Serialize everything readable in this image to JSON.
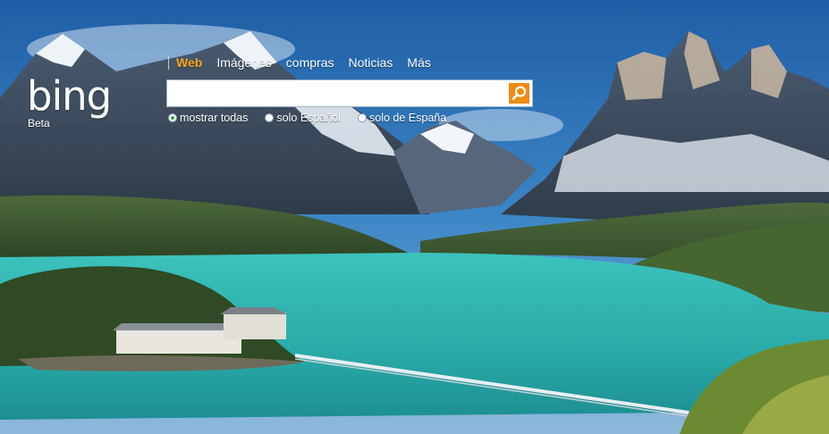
{
  "brand": {
    "logo_text": "bing",
    "beta_label": "Beta"
  },
  "nav": {
    "items": [
      {
        "label": "Web",
        "active": true
      },
      {
        "label": "Imágenes",
        "active": false
      },
      {
        "label": "compras",
        "active": false
      },
      {
        "label": "Noticias",
        "active": false
      },
      {
        "label": "Más",
        "active": false
      }
    ]
  },
  "search": {
    "value": "",
    "placeholder": "",
    "button_icon": "search-icon"
  },
  "scopes": [
    {
      "label": "mostrar todas",
      "checked": true
    },
    {
      "label": "solo Español",
      "checked": false
    },
    {
      "label": "solo de España",
      "checked": false
    }
  ],
  "colors": {
    "accent_orange": "#f08a12",
    "nav_active": "#f7a51d",
    "lake": "#2fb8b4",
    "sky": "#2a6fb0"
  }
}
